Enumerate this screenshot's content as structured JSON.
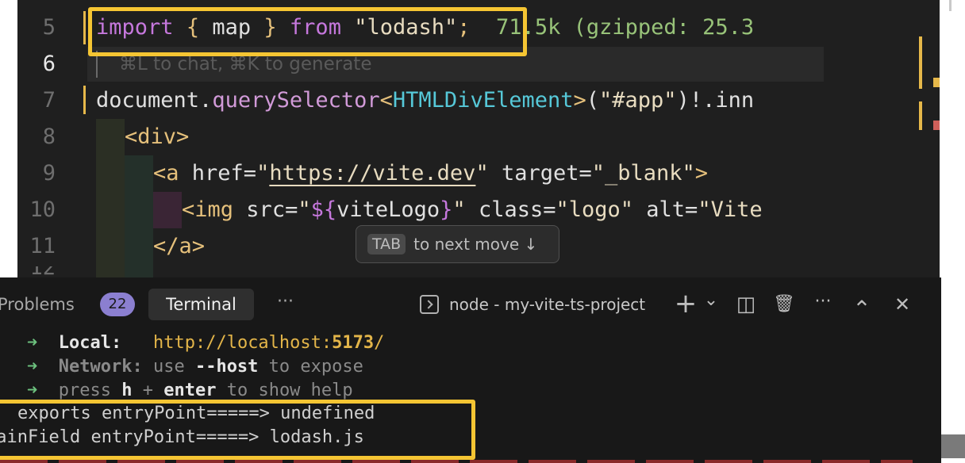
{
  "editor": {
    "line_numbers": [
      "5",
      "6",
      "7",
      "8",
      "9",
      "10",
      "11"
    ],
    "line5": {
      "import": "import",
      "lb": "{",
      "ident": "map",
      "rb": "}",
      "from": "from",
      "module": "\"lodash\"",
      "semi": ";",
      "size_hint": "71.5k (gzipped: 25.3"
    },
    "ghost_hint": "⌘L to chat, ⌘K to generate",
    "line7": {
      "obj": "document",
      "dot": ".",
      "method": "querySelector",
      "lt": "<",
      "type": "HTMLDivElement",
      "gt": ">",
      "open": "(",
      "arg": "\"#app\"",
      "close": ")",
      "rest": "!.inn"
    },
    "line8": {
      "open": "<",
      "tag": "div",
      "close": ">"
    },
    "line9": {
      "open": "<",
      "tag": "a",
      "attr1": " href=",
      "q1": "\"",
      "url": "https://vite.dev",
      "q2": "\"",
      "attr2": " target=",
      "val2": "\"_blank\"",
      "close": ">"
    },
    "line10": {
      "open": "<",
      "tag": "img",
      "attr1": " src=",
      "q1": "\"",
      "interp_open": "${",
      "interp_var": "viteLogo",
      "interp_close": "}",
      "q2": "\"",
      "attr2": " class=",
      "val2": "\"logo\"",
      "attr3": " alt=",
      "val3": "\"Vite"
    },
    "line11": {
      "open": "</",
      "tag": "a",
      "close": ">"
    },
    "tab_hint": {
      "key": "TAB",
      "text": "to next move ↓"
    }
  },
  "panel": {
    "tabs": {
      "problems": "Problems",
      "problems_count": "22",
      "terminal": "Terminal",
      "more": "···"
    },
    "terminal_name": "node - my-vite-ts-project",
    "icons": {
      "add": "+",
      "dropdown": "⌄",
      "split": "◫",
      "trash": "🗑",
      "more": "···",
      "maximize": "⌃",
      "close": "✕"
    }
  },
  "terminal": {
    "lines": [
      {
        "arrow": "➜",
        "label": "Local:",
        "pad": "   ",
        "url_pre": "http://localhost:",
        "url_port": "5173",
        "url_post": "/"
      },
      {
        "arrow": "➜",
        "label": "Network:",
        "rest_pre": " use ",
        "flag": "--host",
        "rest_post": " to expose"
      },
      {
        "arrow": "➜",
        "rest_pre": "press ",
        "key1": "h",
        "plus": " + ",
        "key2": "enter",
        "rest_post": " to show help"
      }
    ],
    "log1": "exports entryPoint=====> undefined",
    "log2": "mainField entryPoint=====> lodash.js"
  },
  "colors": {
    "highlight": "#f5c533",
    "editor_bg": "#1f1f1f",
    "panel_bg": "#181818",
    "badge": "#8b7fd0"
  }
}
